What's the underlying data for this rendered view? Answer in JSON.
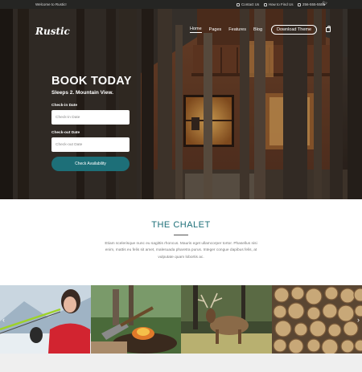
{
  "topbar": {
    "welcome": "Welcome to Rustic!",
    "contact_label": "Contact Us",
    "find_label": "How to Find Us",
    "phone": "256-555-5555",
    "social_icon": "twitter-icon"
  },
  "brand": {
    "logo": "Rustic"
  },
  "nav": {
    "items": [
      "Home",
      "Pages",
      "Features",
      "Blog"
    ],
    "active": "Home",
    "cta": "Download Theme",
    "cart_icon": "cart-icon"
  },
  "booking": {
    "title": "BOOK TODAY",
    "subtitle": "Sleeps 2. Mountain View.",
    "checkin_label": "Check-in Date",
    "checkin_placeholder": "Check-in Date",
    "checkout_label": "Check-out Date",
    "checkout_placeholder": "Check-out Date",
    "button": "Check Availability"
  },
  "chalet": {
    "title": "THE CHALET",
    "body": "Etiam scelerisque nunc eu sagittis rhoncus. Mauris eget ullamcorper tortor. Phasellus nisi enim, mattis eu felis sit amet, malesuada pharetra purus. Integer congue dapibus felis, at vulputate quam lobortis ac."
  },
  "gallery": {
    "images": [
      "archer-woman",
      "axe-campfire",
      "elk-in-forest",
      "firewood-stack"
    ],
    "prev_icon": "chevron-left-icon",
    "next_icon": "chevron-right-icon"
  },
  "colors": {
    "accent": "#1d6f78",
    "topbar": "#121210"
  }
}
